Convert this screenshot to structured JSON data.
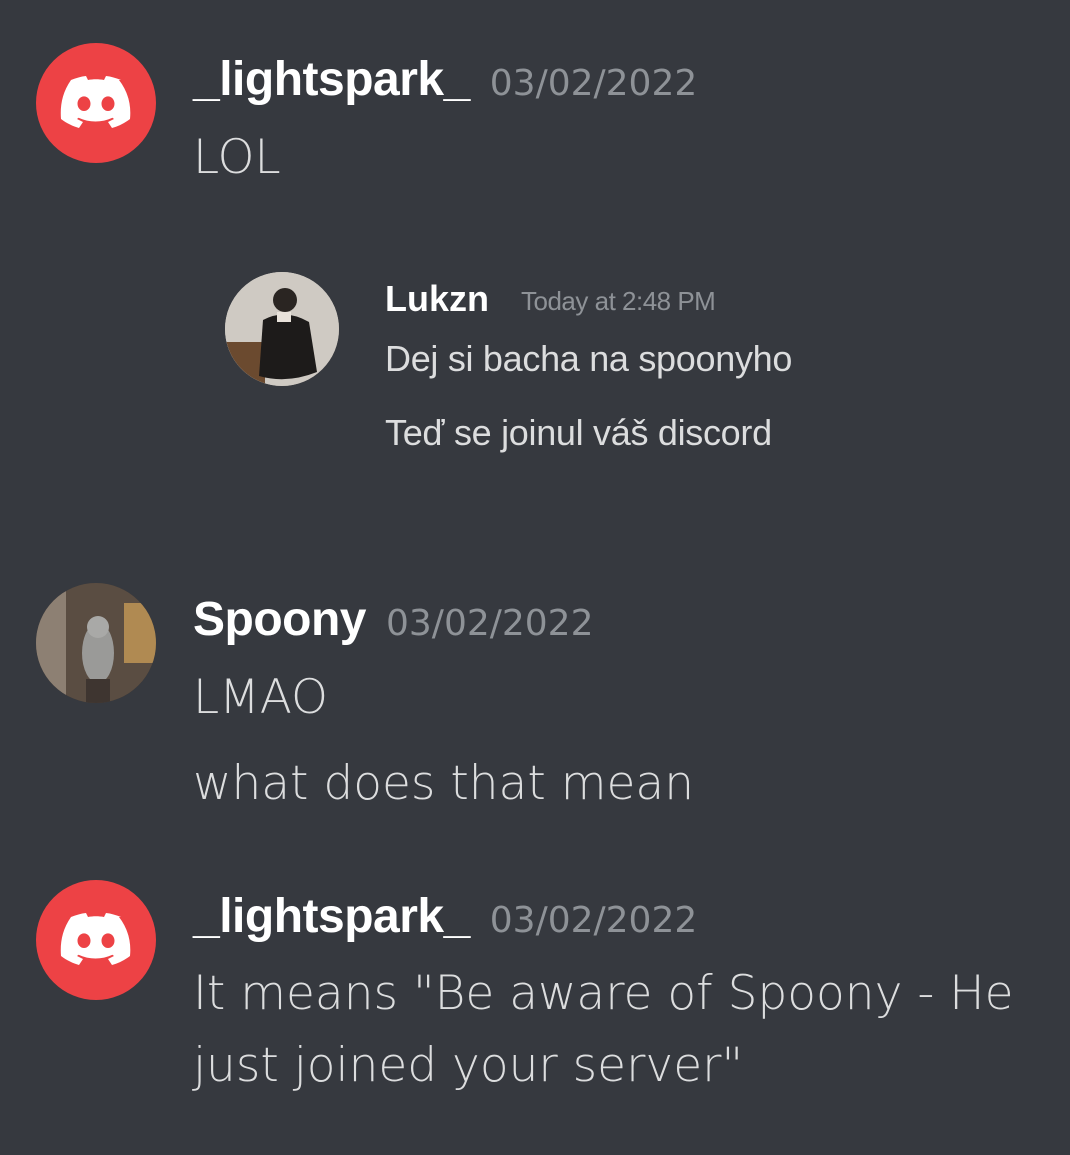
{
  "messages": [
    {
      "username": "_lightspark_",
      "timestamp": "03/02/2022",
      "avatar": "discord-logo-icon",
      "lines": [
        "LOL"
      ]
    },
    {
      "embedded_screenshot": {
        "username": "Lukzn",
        "timestamp": "Today at 2:48 PM",
        "avatar": "user-photo",
        "lines": [
          "Dej si bacha na spoonyho",
          "Teď se joinul váš discord"
        ]
      }
    },
    {
      "username": "Spoony",
      "timestamp": "03/02/2022",
      "avatar": "user-photo",
      "lines": [
        "LMAO",
        "what does that mean"
      ]
    },
    {
      "username": "_lightspark_",
      "timestamp": "03/02/2022",
      "avatar": "discord-logo-icon",
      "lines": [
        "It means \"Be aware of Spoony - He",
        "just joined your server\""
      ]
    }
  ],
  "colors": {
    "background": "#36393f",
    "discord_red": "#ed4245",
    "username": "#ffffff",
    "timestamp": "#8e9297",
    "text": "#dcddde"
  }
}
